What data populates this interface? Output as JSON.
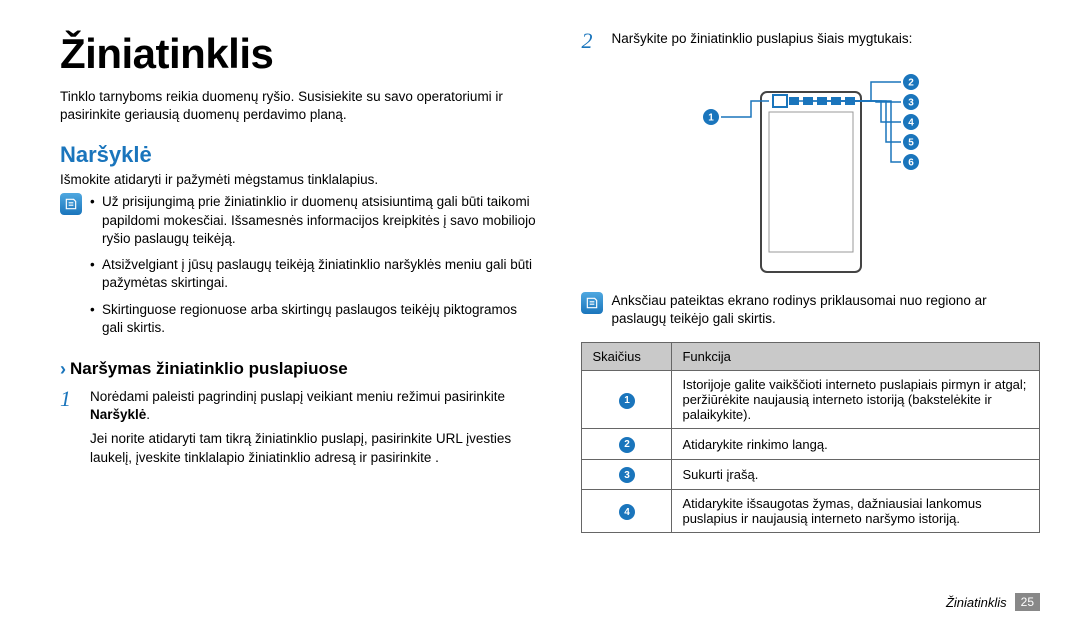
{
  "left": {
    "title": "Žiniatinklis",
    "intro": "Tinklo tarnyboms reikia duomenų ryšio. Susisiekite su savo operatoriumi ir pasirinkite geriausią duomenų perdavimo planą.",
    "h2": "Naršyklė",
    "sub": "Išmokite atidaryti ir pažymėti mėgstamus tinklalapius.",
    "bullets": [
      "Už prisijungimą prie žiniatinklio ir duomenų atsisiuntimą gali būti taikomi papildomi mokesčiai. Išsamesnės informacijos kreipkitės į savo mobiliojo ryšio paslaugų teikėją.",
      "Atsižvelgiant į jūsų paslaugų teikėją žiniatinklio naršyklės meniu gali būti pažymėtas skirtingai.",
      "Skirtinguose regionuose arba skirtingų paslaugos teikėjų piktogramos gali skirtis."
    ],
    "h3": "Naršymas žiniatinklio puslapiuose",
    "step1_prefix": "Norėdami paleisti pagrindinį puslapį veikiant meniu režimui pasirinkite ",
    "step1_bold": "Naršyklė",
    "step1_suffix": ".",
    "step1b": "Jei norite atidaryti tam tikrą žiniatinklio puslapį, pasirinkite URL įvesties laukelį, įveskite tinklalapio žiniatinklio adresą ir pasirinkite      ."
  },
  "right": {
    "step2": "Naršykite po žiniatinklio puslapius šiais mygtukais:",
    "note": "Anksčiau pateiktas ekrano rodinys priklausomai nuo regiono ar paslaugų teikėjo gali skirtis.",
    "table": {
      "h1": "Skaičius",
      "h2": "Funkcija",
      "rows": [
        {
          "n": "1",
          "f": "Istorijoje galite vaikščioti interneto puslapiais pirmyn ir atgal; peržiūrėkite naujausią interneto istoriją (bakstelėkite ir palaikykite)."
        },
        {
          "n": "2",
          "f": "Atidarykite rinkimo langą."
        },
        {
          "n": "3",
          "f": "Sukurti įrašą."
        },
        {
          "n": "4",
          "f": "Atidarykite išsaugotas žymas, dažniausiai lankomus puslapius ir naujausią interneto naršymo istoriją."
        }
      ]
    }
  },
  "footer": {
    "section": "Žiniatinklis",
    "page": "25"
  },
  "nums": {
    "n1": "1",
    "n2": "2",
    "n3": "3",
    "n4": "4",
    "n5": "5",
    "n6": "6"
  }
}
